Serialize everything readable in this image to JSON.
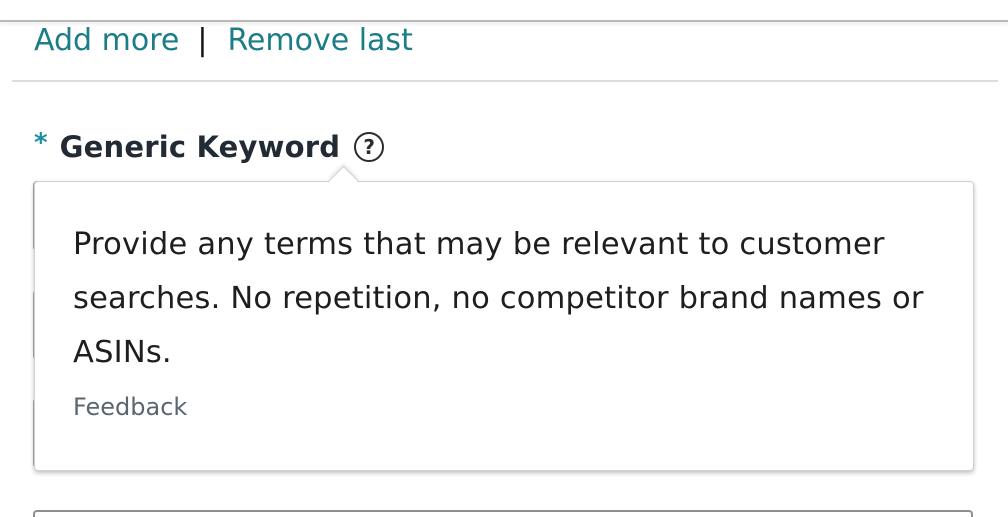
{
  "actions": {
    "add_more": "Add more",
    "separator": "|",
    "remove_last": "Remove last"
  },
  "field": {
    "required_marker": "*",
    "label": "Generic Keyword",
    "help_icon": "question-circle-icon",
    "help_glyph": "?"
  },
  "tooltip": {
    "text": "Provide any terms that may be relevant to customer searches. No repetition, no competitor brand names or ASINs.",
    "feedback": "Feedback"
  },
  "colors": {
    "link": "#1b7d87",
    "required": "#1b8fa0",
    "label": "#222b33"
  }
}
